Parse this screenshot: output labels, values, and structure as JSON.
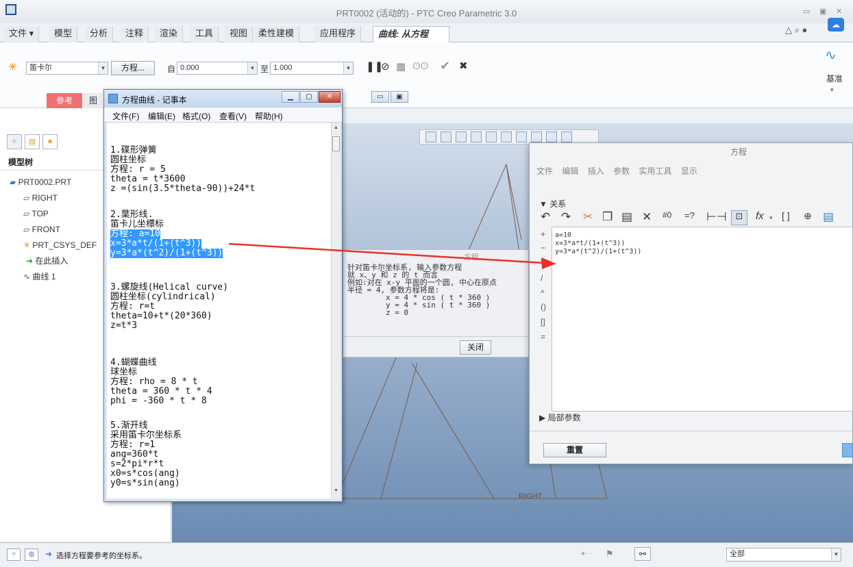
{
  "app": {
    "title": "PRT0002 (活动的) - PTC Creo Parametric 3.0"
  },
  "ribbon": {
    "tabs": [
      "文件",
      "模型",
      "分析",
      "注释",
      "渲染",
      "工具",
      "视图",
      "柔性建模",
      "应用程序",
      "曲线: 从方程"
    ],
    "coord_type": "笛卡尔",
    "equation_button": "方程...",
    "from_label": "自",
    "from_value": "0.000",
    "to_label": "至",
    "to_value": "1.000",
    "datum_label": "基准",
    "sub_tabs": [
      "参考",
      "图"
    ]
  },
  "model_tree": {
    "title": "模型树",
    "items": [
      "PRT0002.PRT",
      "RIGHT",
      "TOP",
      "FRONT",
      "PRT_CSYS_DEF",
      "在此插入",
      "曲线 1"
    ]
  },
  "viewport": {
    "datum_label": "RIGHT"
  },
  "notepad": {
    "title": "方程曲线 - 记事本",
    "menu": [
      "文件(F)",
      "编辑(E)",
      "格式(O)",
      "查看(V)",
      "帮助(H)"
    ],
    "lines": [
      "1.碟形弹簧",
      "圆柱坐标",
      "方程: r = 5",
      "theta = t*3600",
      "z =(sin(3.5*theta-90))+24*t",
      "2.葉形线.",
      "笛卡儿坐標标",
      "方程: a=10",
      "x=3*a*t/(1+(t^3))",
      "y=3*a*(t^2)/(1+(t^3))",
      "3.螺旋线(Helical curve)",
      "圆柱坐标(cylindrical)",
      "方程: r=t",
      "theta=10+t*(20*360)",
      "z=t*3",
      "4.蝴蝶曲线",
      "球坐标",
      "方程: rho = 8 * t",
      "theta = 360 * t * 4",
      "phi = -360 * t * 8",
      "5.渐开线",
      "采用笛卡尔坐标系",
      "方程: r=1",
      "ang=360*t",
      "s=2*pi*r*t",
      "x0=s*cos(ang)",
      "y0=s*sin(ang)"
    ]
  },
  "help_dialog": {
    "title": "方程",
    "lines": [
      "针对笛卡尔坐标系, 输入参数方程",
      "就 x、y 和 z 的 t 而言",
      "例如:对在 x-y 平面的一个圆, 中心在原点",
      "半径 = 4, 参数方程将是:",
      "x = 4 * cos ( t * 360 )",
      "y = 4 * sin ( t * 360 )",
      "z = 0"
    ],
    "close_button": "关闭"
  },
  "equation_dialog": {
    "title": "方程",
    "menu": [
      "文件",
      "编辑",
      "插入",
      "参数",
      "实用工具",
      "显示"
    ],
    "section": "关系",
    "lines": [
      "a=10",
      "x=3*a*t/(1+(t^3))",
      "y=3*a*(t^2)/(1+(t^3))"
    ],
    "local_params": "局部参数",
    "reset_button": "重置"
  },
  "status": {
    "message": "选择方程要参考的坐标系。",
    "filter": "全部"
  },
  "colors": {
    "selection": "#3399ff",
    "arrow": "#e8312a",
    "subtab_active": "#f07070"
  }
}
